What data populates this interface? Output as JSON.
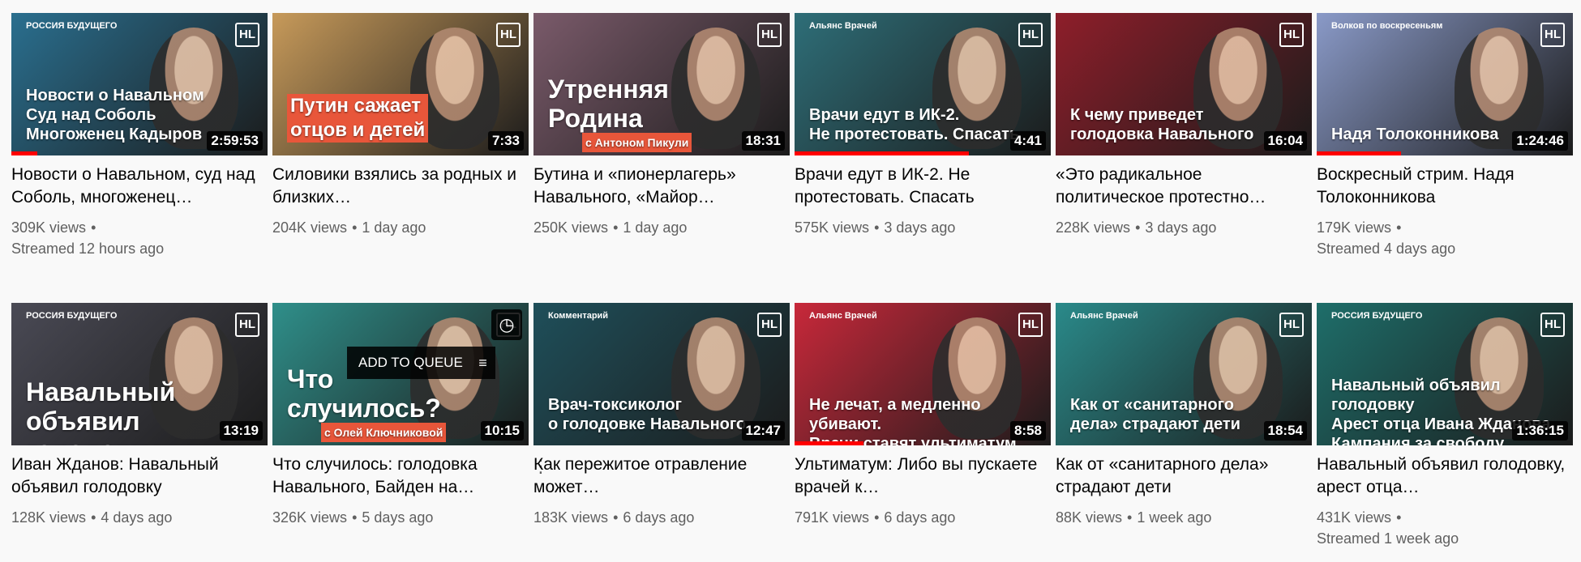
{
  "queue_label": "ADD TO QUEUE",
  "videos": [
    {
      "title": "Новости о Навальном, суд над Соболь, многоженец…",
      "views": "309K views",
      "age": "Streamed 12 hours ago",
      "duration": "2:59:53",
      "tag": "РОССИЯ БУДУЩЕГО",
      "overlay": "Новости о Навальном\nСуд над Соболь\nМногоженец Кадыров",
      "progress": 0.1,
      "bg": "#2a6f8f"
    },
    {
      "title": "Силовики взялись за родных и близких…",
      "views": "204K views",
      "age": "1 day ago",
      "duration": "7:33",
      "tag": "",
      "overlay": "Путин сажает\nотцов и детей",
      "progress": 0,
      "bg": "#c79a5a"
    },
    {
      "title": "Бутина и «пионерлагерь» Навального, «Майор…",
      "views": "250K views",
      "age": "1 day ago",
      "duration": "18:31",
      "tag": "",
      "overlay": "Утренняя\nРодина",
      "sub": "с Антоном Пикули",
      "progress": 0,
      "bg": "#7a5a6a"
    },
    {
      "title": "Врачи едут в ИК-2. Не протестовать. Спасать",
      "views": "575K views",
      "age": "3 days ago",
      "duration": "4:41",
      "tag": "Альянс Врачей",
      "overlay": "Врачи едут в ИК-2.\nНе протестовать. Спасать",
      "progress": 0.68,
      "bg": "#2e6e78"
    },
    {
      "title": "«Это радикальное политическое протестно…",
      "views": "228K views",
      "age": "3 days ago",
      "duration": "16:04",
      "tag": "",
      "overlay": "К чему приведет\nголодовка Навального",
      "progress": 0,
      "bg": "#8e1e2a"
    },
    {
      "title": "Воскресный стрим. Надя Толоконникова",
      "views": "179K views",
      "age": "Streamed 4 days ago",
      "duration": "1:24:46",
      "tag": "Волков по воскресеньям",
      "overlay": "Надя Толоконникова",
      "progress": 0.33,
      "bg": "#8a9ac8"
    },
    {
      "title": "Иван Жданов: Навальный объявил голодовку",
      "views": "128K views",
      "age": "4 days ago",
      "duration": "13:19",
      "tag": "РОССИЯ БУДУЩЕГО",
      "overlay": "Навальный\nобъявил голодовку",
      "progress": 0,
      "bg": "#4a4a55"
    },
    {
      "title": "Что случилось: голодовка Навального, Байден на…",
      "views": "326K views",
      "age": "5 days ago",
      "duration": "10:15",
      "tag": "",
      "overlay": "Что\nслучилось?",
      "sub": "с Олей Ключниковой",
      "progress": 0,
      "bg": "#2f8f8a"
    },
    {
      "title": "Как пережитое отравление может…",
      "views": "183K views",
      "age": "6 days ago",
      "duration": "12:47",
      "tag": "Комментарий",
      "overlay": "Врач-токсиколог\nо голодовке Навального",
      "progress": 0,
      "bg": "#1f4f5a"
    },
    {
      "title": "Ультиматум: Либо вы пускаете врачей к…",
      "views": "791K views",
      "age": "6 days ago",
      "duration": "8:58",
      "tag": "Альянс Врачей",
      "overlay": "Не лечат, а медленно убивают.\nВрачи ставят ультиматум",
      "progress": 0.27,
      "bg": "#c8283a"
    },
    {
      "title": "Как от «санитарного дела» страдают дети",
      "views": "88K views",
      "age": "1 week ago",
      "duration": "18:54",
      "tag": "Альянс Врачей",
      "overlay": "Как от «санитарного\nдела» страдают дети",
      "progress": 0,
      "bg": "#2a8a8a"
    },
    {
      "title": "Навальный объявил голодовку, арест отца…",
      "views": "431K views",
      "age": "Streamed 1 week ago",
      "duration": "1:36:15",
      "tag": "РОССИЯ БУДУЩЕГО",
      "overlay": "Навальный объявил голодовку\nАрест отца Ивана Жданова\nКампания за свободу Навального",
      "progress": 0,
      "bg": "#1e6e6a"
    }
  ],
  "colors": {
    "progress": "#ff0000",
    "meta": "#606060",
    "logo_text": "HL"
  }
}
